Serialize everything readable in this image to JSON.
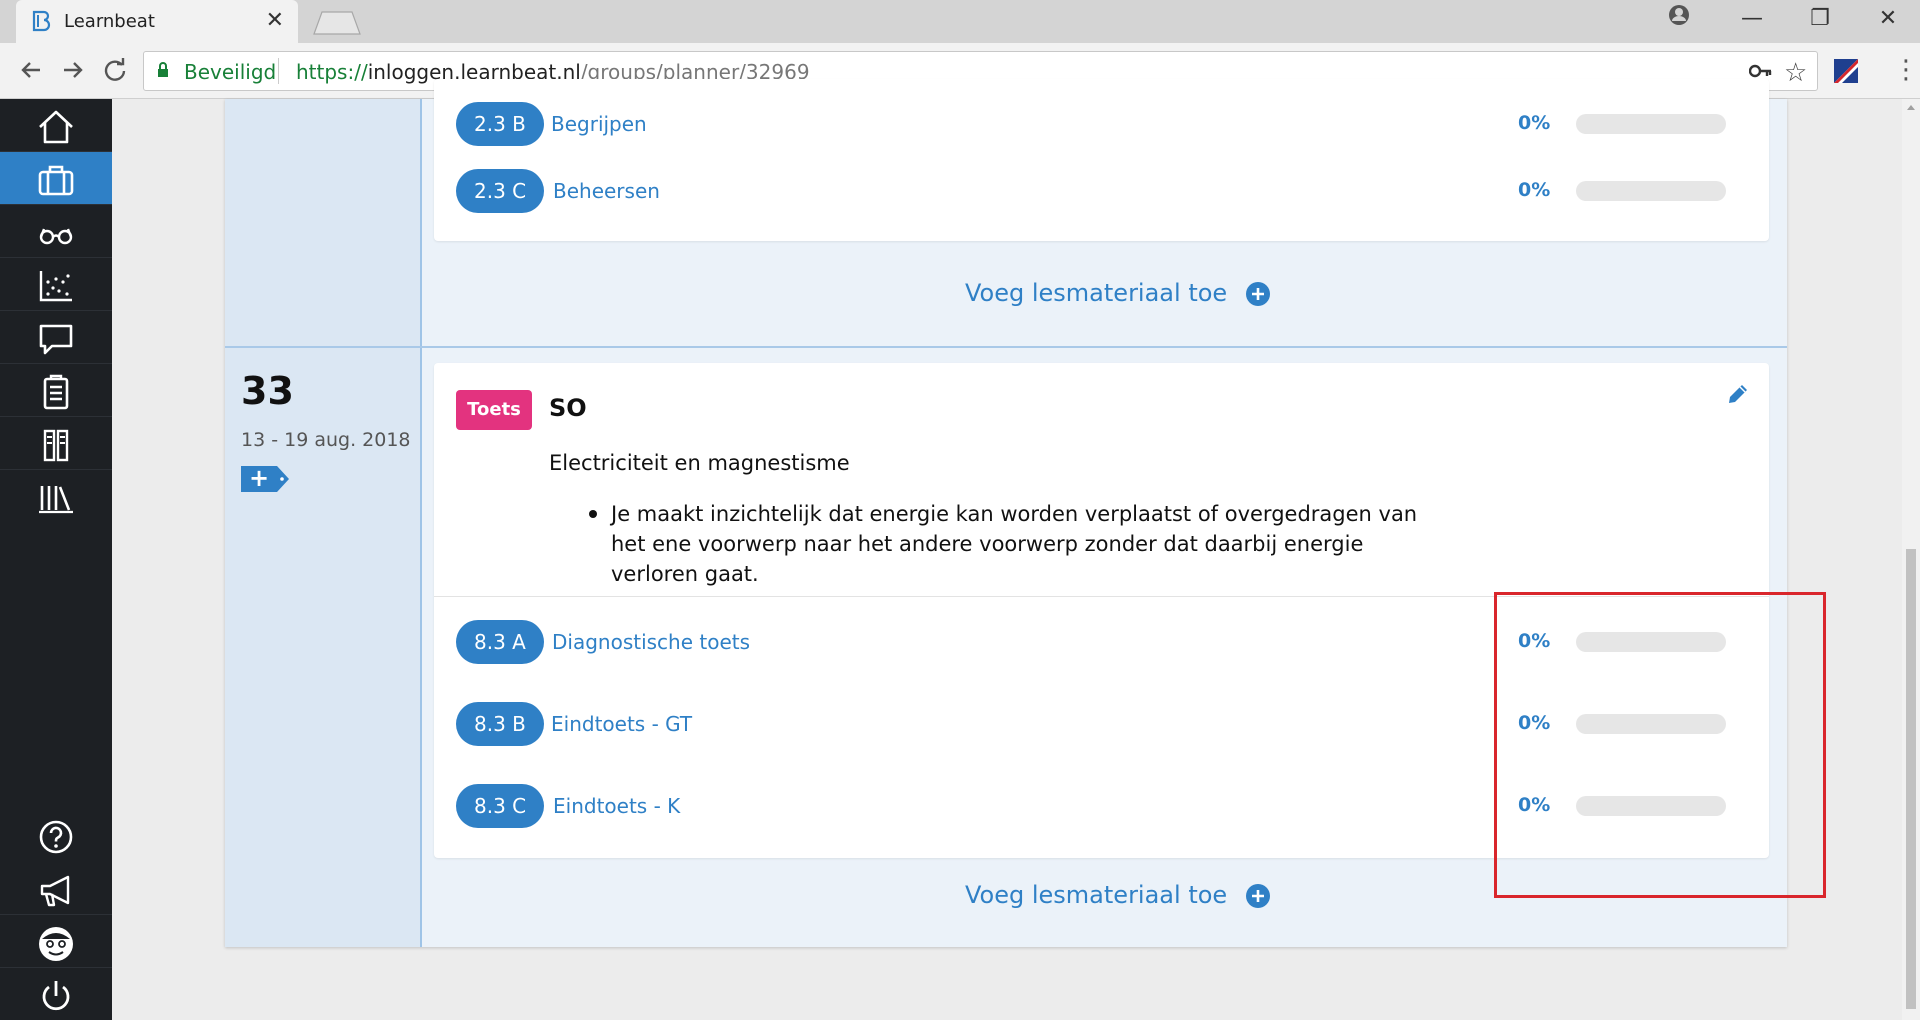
{
  "browser": {
    "tab_title": "Learnbeat",
    "tab_close": "✕",
    "secure_label": "Beveiligd",
    "url_scheme": "https://",
    "url_host": "inloggen.learnbeat.nl",
    "url_path": "/groups/planner/32969",
    "win_minimize": "—",
    "win_restore": "❐",
    "win_close": "✕",
    "star": "☆",
    "menu": "⋮"
  },
  "sidebar": {
    "items": [
      {
        "icon": "home-icon"
      },
      {
        "icon": "briefcase-icon",
        "active": true
      },
      {
        "icon": "glasses-icon"
      },
      {
        "icon": "chart-icon"
      },
      {
        "icon": "chat-icon"
      },
      {
        "icon": "clipboard-icon"
      },
      {
        "icon": "books-icon"
      },
      {
        "icon": "library-icon"
      }
    ],
    "bottom_items": [
      {
        "icon": "help-icon"
      },
      {
        "icon": "megaphone-icon"
      },
      {
        "icon": "avatar-icon"
      },
      {
        "icon": "power-icon"
      }
    ]
  },
  "week_prev": {
    "items": [
      {
        "code": "2.3 B",
        "title": "Begrijpen",
        "percent": "0%",
        "progress": 0
      },
      {
        "code": "2.3 C",
        "title": "Beheersen",
        "percent": "0%",
        "progress": 0
      }
    ],
    "add_material": "Voeg lesmateriaal toe"
  },
  "week_33": {
    "number": "33",
    "dates": "13 - 19 aug. 2018",
    "add_tag": "+",
    "test": {
      "badge": "Toets",
      "title": "SO",
      "description": "Electriciteit en magnestisme",
      "bullets": [
        "Je maakt inzichtelijk dat energie kan worden verplaatst of overgedragen van het ene voorwerp naar het andere voorwerp zonder dat daarbij energie verloren gaat."
      ]
    },
    "items": [
      {
        "code": "8.3 A",
        "title": "Diagnostische toets",
        "percent": "0%",
        "progress": 0
      },
      {
        "code": "8.3 B",
        "title": "Eindtoets - GT",
        "percent": "0%",
        "progress": 0
      },
      {
        "code": "8.3 C",
        "title": "Eindtoets - K",
        "percent": "0%",
        "progress": 0
      }
    ],
    "add_material": "Voeg lesmateriaal toe"
  },
  "colors": {
    "accent": "#2f80c6",
    "badge": "#e3337f",
    "highlight": "#d9262c",
    "sidebar": "#1d2024"
  }
}
